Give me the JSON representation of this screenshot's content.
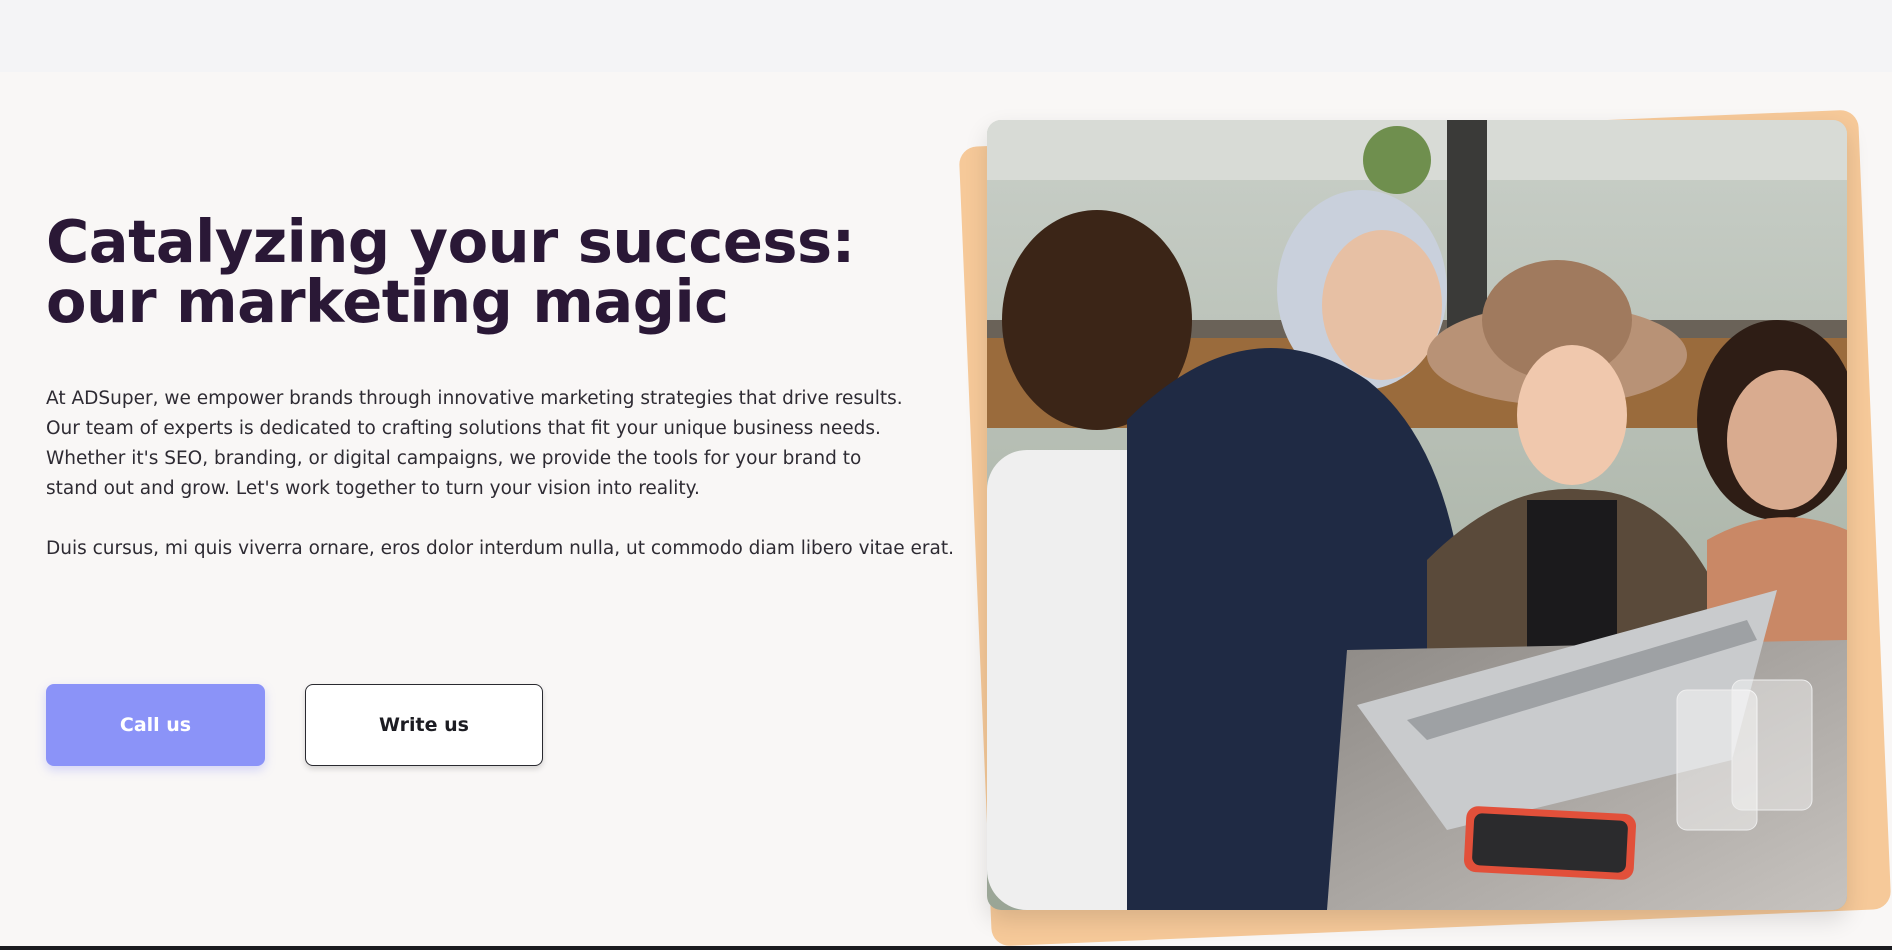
{
  "hero": {
    "headline": "Catalyzing your success: our marketing magic",
    "paragraph_1": "At ADSuper, we empower brands through innovative marketing strategies that drive results. Our team of experts is dedicated to crafting solutions that fit your unique business needs. Whether it's SEO, branding, or digital campaigns, we provide the tools for your brand to stand out and grow. Let's work together to turn your vision into reality.",
    "paragraph_2": "Duis cursus, mi quis viverra ornare, eros dolor interdum nulla, ut commodo diam libero vitae erat."
  },
  "buttons": {
    "call_label": "Call us",
    "write_label": "Write us"
  },
  "colors": {
    "accent": "#8b93f8",
    "photo_frame": "#f6c999",
    "headline": "#2a1836"
  }
}
